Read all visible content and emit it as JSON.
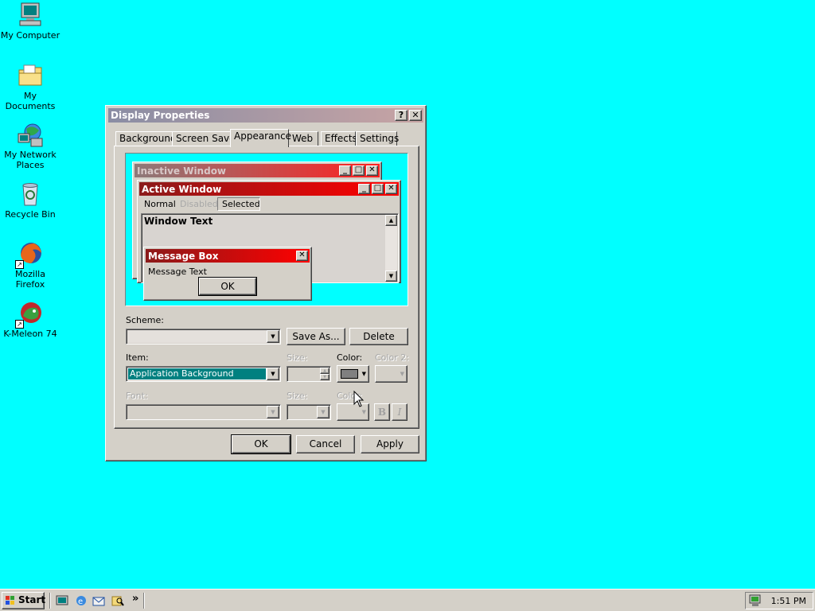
{
  "desktop": {
    "icons": [
      {
        "label": "My Computer"
      },
      {
        "label": "My Documents"
      },
      {
        "label": "My Network Places"
      },
      {
        "label": "Recycle Bin"
      },
      {
        "label": "Mozilla Firefox"
      },
      {
        "label": "K-Meleon 74"
      }
    ]
  },
  "window": {
    "title": "Display Properties",
    "help_btn": "?",
    "close_btn": "✕",
    "tabs": [
      "Background",
      "Screen Saver",
      "Appearance",
      "Web",
      "Effects",
      "Settings"
    ],
    "active_tab": "Appearance",
    "preview": {
      "inactive_title": "Inactive Window",
      "active_title": "Active Window",
      "menu": {
        "normal": "Normal",
        "disabled": "Disabled",
        "selected": "Selected"
      },
      "window_text": "Window Text",
      "msgbox_title": "Message Box",
      "msgbox_text": "Message Text",
      "msgbox_ok": "OK"
    },
    "scheme": {
      "label": "Scheme:",
      "value": "",
      "save_as": "Save As...",
      "delete": "Delete"
    },
    "item": {
      "label": "Item:",
      "value": "Application Background",
      "size_label": "Size:",
      "color_label": "Color:",
      "color2_label": "Color 2:",
      "color_value": "#808080"
    },
    "font": {
      "label": "Font:",
      "size_label": "Size:",
      "color_label": "Color:",
      "bold": "B",
      "italic": "I"
    },
    "buttons": {
      "ok": "OK",
      "cancel": "Cancel",
      "apply": "Apply"
    }
  },
  "taskbar": {
    "start": "Start",
    "chevron": "»",
    "time": "1:51 PM"
  },
  "colors": {
    "desktop": "#00ffff",
    "face": "#d4d0c8",
    "active_title_start": "#8b1a1a",
    "active_title_end": "#ff0000",
    "selection": "#008080"
  }
}
